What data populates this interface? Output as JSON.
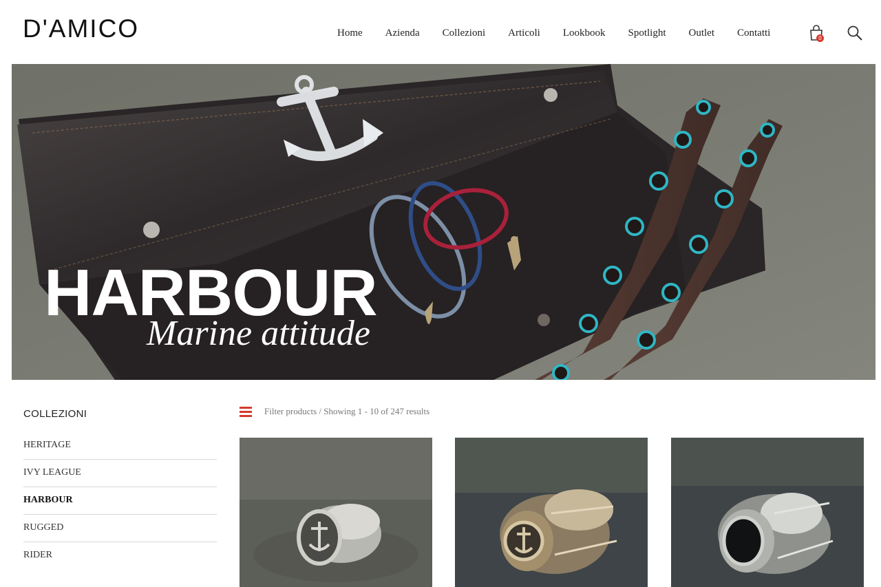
{
  "brand": {
    "logo_text": "D'AMICO"
  },
  "nav": {
    "items": [
      "Home",
      "Azienda",
      "Collezioni",
      "Articoli",
      "Lookbook",
      "Spotlight",
      "Outlet",
      "Contatti"
    ],
    "cart_count": "0",
    "cart_icon": "shopping-bag-icon",
    "search_icon": "search-icon"
  },
  "hero": {
    "title": "HARBOUR",
    "subtitle": "Marine attitude"
  },
  "sidebar": {
    "title": "COLLEZIONI",
    "items": [
      {
        "label": "HERITAGE"
      },
      {
        "label": "IVY LEAGUE"
      },
      {
        "label": "HARBOUR",
        "active": true
      },
      {
        "label": "RUGGED"
      },
      {
        "label": "RIDER"
      }
    ]
  },
  "filter": {
    "icon": "menu-icon",
    "text": "Filter products / Showing 1 - 10 of 247 results"
  },
  "colors": {
    "accent": "#d43a2e",
    "eyelet": "#2fb6c4",
    "leather": "#3a3434"
  }
}
